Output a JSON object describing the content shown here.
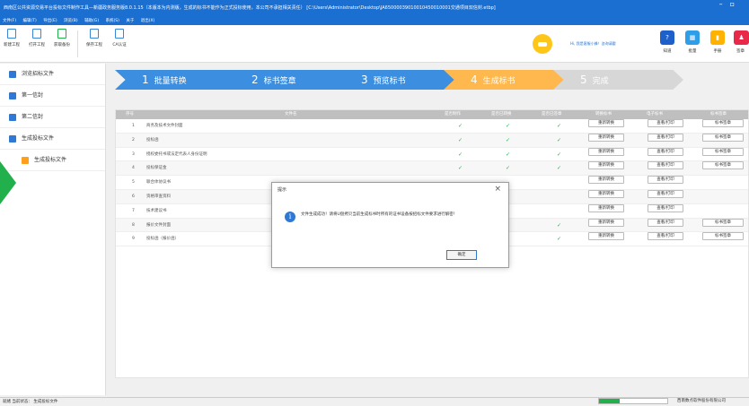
{
  "titlebar": {
    "title": "西南区公共资源交易平台投标文件制作工具—新疆政务服务版8.0.1.15（本版本为内测版，生成的标书不能作为正式投标使用，本公司不承担相关责任）    [C:\\Users\\Administrator\\Desktop\\JA65000039010010450010001交通项目双信封.etbp]"
  },
  "menu": [
    "文件(F)",
    "编辑(T)",
    "导出(E)",
    "浏览(B)",
    "辅助(G)",
    "系统(S)",
    "关于",
    "退出(X)"
  ],
  "toolbar": {
    "buttons": [
      "新建工程",
      "打开工程",
      "获取备份",
      "保存工程",
      "CA认证"
    ],
    "hello": "Hi, 我是客服小蜂！咨询请戳",
    "right_buttons": [
      {
        "label": "知道",
        "color": "#1e5fc9",
        "icon": "?"
      },
      {
        "label": "批量",
        "color": "#2f9ee8",
        "icon": "▦"
      },
      {
        "label": "手册",
        "color": "#ffb300",
        "icon": "▮"
      },
      {
        "label": "签章",
        "color": "#e8294a",
        "icon": "♟"
      }
    ]
  },
  "sidebar": {
    "items": [
      "浏览招标文件",
      "第一信封",
      "第二信封",
      "生成投标文件"
    ],
    "sub_item": "生成投标文件"
  },
  "steps": [
    {
      "num": "1",
      "label": "批量转换",
      "color": "#3c8fe0"
    },
    {
      "num": "2",
      "label": "标书签章",
      "color": "#3c8fe0"
    },
    {
      "num": "3",
      "label": "预览标书",
      "color": "#3c8fe0"
    },
    {
      "num": "4",
      "label": "生成标书",
      "color": "#ffb84d"
    },
    {
      "num": "5",
      "label": "完成",
      "color": "#d7d7d7"
    }
  ],
  "table": {
    "headers": [
      "序号",
      "文件名",
      "是否制作",
      "是否已转换",
      "是否已签章",
      "转换标书",
      "电子标书",
      "标书签章"
    ],
    "rows": [
      {
        "no": "1",
        "name": "商务及技术文件封面",
        "made": "✓",
        "converted": "✓",
        "signed": "✓",
        "convert_btn": "重新转换",
        "view_btn": "查看/打印",
        "sign_btn": "标书签章"
      },
      {
        "no": "2",
        "name": "投标函",
        "made": "✓",
        "converted": "✓",
        "signed": "✓",
        "convert_btn": "重新转换",
        "view_btn": "查看/打印",
        "sign_btn": "标书签章"
      },
      {
        "no": "3",
        "name": "授权委托书或法定代表人身份证明",
        "made": "✓",
        "converted": "✓",
        "signed": "✓",
        "convert_btn": "重新转换",
        "view_btn": "查看/打印",
        "sign_btn": "标书签章"
      },
      {
        "no": "4",
        "name": "投标保证金",
        "made": "✓",
        "converted": "✓",
        "signed": "✓",
        "convert_btn": "重新转换",
        "view_btn": "查看/打印",
        "sign_btn": "标书签章"
      },
      {
        "no": "5",
        "name": "联合体协议书",
        "made": "",
        "converted": "",
        "signed": "",
        "convert_btn": "重新转换",
        "view_btn": "查看/打印",
        "sign_btn": ""
      },
      {
        "no": "6",
        "name": "资格审查资料",
        "made": "",
        "converted": "",
        "signed": "",
        "convert_btn": "重新转换",
        "view_btn": "查看/打印",
        "sign_btn": ""
      },
      {
        "no": "7",
        "name": "技术建议书",
        "made": "",
        "converted": "",
        "signed": "",
        "convert_btn": "重新转换",
        "view_btn": "查看/打印",
        "sign_btn": ""
      },
      {
        "no": "8",
        "name": "报价文件封面",
        "made": "",
        "converted": "",
        "signed": "✓",
        "convert_btn": "重新转换",
        "view_btn": "查看/打印",
        "sign_btn": "标书签章"
      },
      {
        "no": "9",
        "name": "投标函（报价函）",
        "made": "",
        "converted": "",
        "signed": "✓",
        "convert_btn": "重新转换",
        "view_btn": "查看/打印",
        "sign_btn": "标书签章"
      }
    ]
  },
  "dialog": {
    "title": "提示",
    "close": "×",
    "icon": "i",
    "message": "文件生成成功！请将U盘拷贝当前生成标书时所有的证书设备按招标文件要求进行解密！",
    "ok": "确定"
  },
  "statusbar": {
    "text": "就绪  当前状态： 生成投标文件",
    "progress": 0.3,
    "right": "西南数点软件股份有限公司"
  },
  "colors": {
    "titlebar": "#1b6fd0",
    "accent": "#2f78d4",
    "check": "#21b04b"
  }
}
